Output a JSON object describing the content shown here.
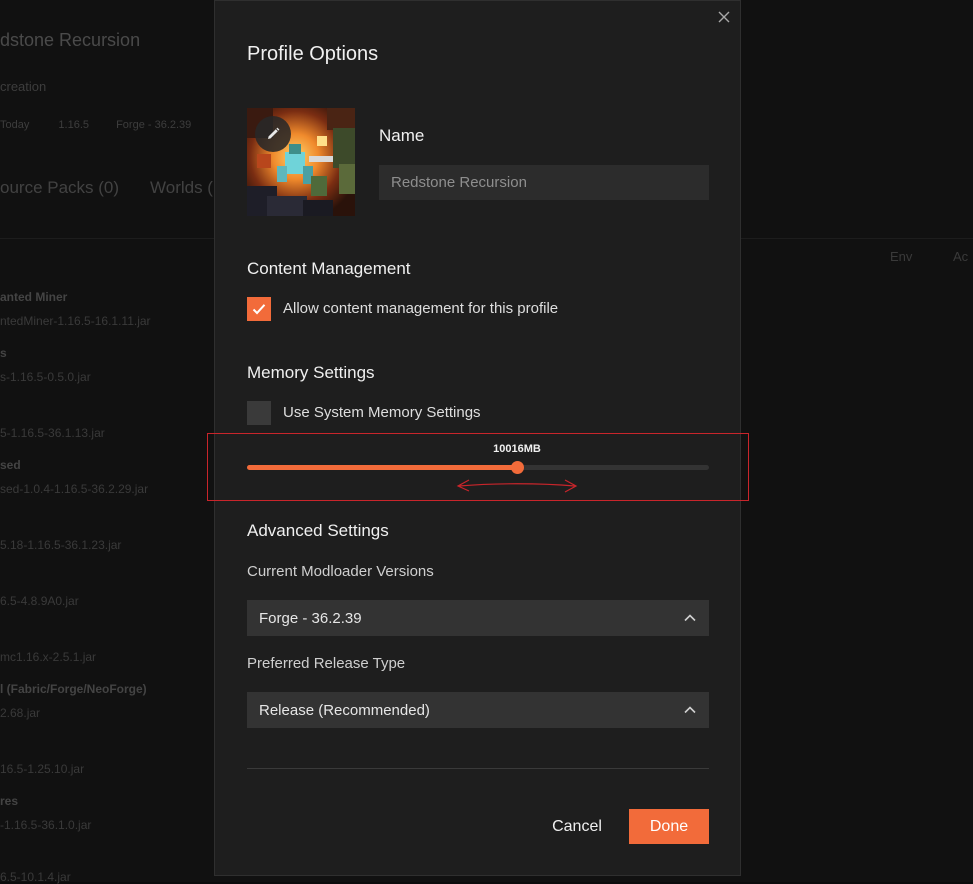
{
  "background": {
    "profile_title": "dstone Recursion",
    "profile_subtitle": "creation",
    "meta": {
      "updated": "Today",
      "game_version": "1.16.5",
      "loader": "Forge - 36.2.39"
    },
    "tabs": [
      "ource Packs (0)",
      "Worlds ("
    ],
    "columns": [
      "Env",
      "Ac"
    ],
    "rows": [
      {
        "name": "anted Miner",
        "file": "ntedMiner-1.16.5-16.1.11.jar"
      },
      {
        "name": "s",
        "file": "s-1.16.5-0.5.0.jar"
      },
      {
        "name": "",
        "file": "5-1.16.5-36.1.13.jar"
      },
      {
        "name": "sed",
        "file": "sed-1.0.4-1.16.5-36.2.29.jar"
      },
      {
        "name": "",
        "file": "5.18-1.16.5-36.1.23.jar"
      },
      {
        "name": "",
        "file": "6.5-4.8.9A0.jar"
      },
      {
        "name": "",
        "file": "mc1.16.x-2.5.1.jar"
      },
      {
        "name": "l (Fabric/Forge/NeoForge)",
        "file": "2.68.jar"
      },
      {
        "name": "",
        "file": "16.5-1.25.10.jar"
      },
      {
        "name": "res",
        "file": "-1.16.5-36.1.0.jar"
      },
      {
        "name": "",
        "file": "6.5-10.1.4.jar"
      }
    ]
  },
  "modal": {
    "title": "Profile Options",
    "name_label": "Name",
    "name_placeholder": "Redstone Recursion",
    "content_section": "Content Management",
    "content_checkbox_label": "Allow content management for this profile",
    "content_checked": true,
    "memory_section": "Memory Settings",
    "memory_checkbox_label": "Use System Memory Settings",
    "memory_checked": false,
    "memory_value": "10016MB",
    "memory_fraction": 0.585,
    "advanced_section": "Advanced Settings",
    "modloader_label": "Current Modloader Versions",
    "modloader_value": "Forge - 36.2.39",
    "release_label": "Preferred Release Type",
    "release_value": "Release (Recommended)",
    "cancel_label": "Cancel",
    "done_label": "Done"
  },
  "colors": {
    "accent": "#f26b3a",
    "annotation": "#c9252b",
    "modal_bg": "#1e1e1e"
  },
  "icons": {
    "close": "close-icon",
    "edit": "pencil-icon",
    "check": "check-icon",
    "chevron": "chevron-up-icon"
  }
}
